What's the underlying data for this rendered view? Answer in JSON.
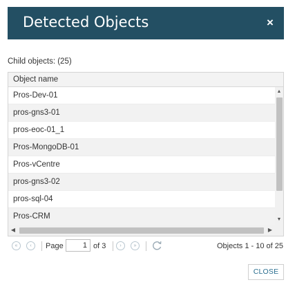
{
  "dialog": {
    "title": "Detected Objects",
    "close_icon": "×"
  },
  "child_objects_label": "Child objects: (25)",
  "grid": {
    "column_header": "Object name",
    "rows": [
      "Pros-Dev-01",
      "pros-gns3-01",
      "pros-eoc-01_1",
      "Pros-MongoDB-01",
      "Pros-vCentre",
      "pros-gns3-02",
      "pros-sql-04",
      "Pros-CRM"
    ]
  },
  "pager": {
    "page_label": "Page",
    "page_value": "1",
    "of_label": "of 3",
    "status": "Objects 1 - 10 of 25"
  },
  "footer": {
    "close_label": "CLOSE"
  },
  "colors": {
    "header_bg": "#234f63",
    "accent": "#2a6e8f",
    "alt_row": "#f2f2f2"
  }
}
